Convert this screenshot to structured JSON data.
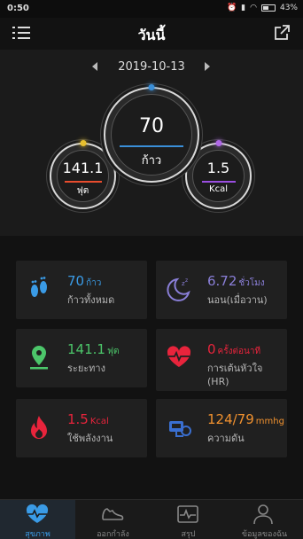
{
  "status_bar": {
    "time": "0:50",
    "battery": "43%",
    "signal": "signal-icon",
    "wifi": "wifi-icon",
    "alarm": "alarm-icon"
  },
  "header": {
    "title": "วันนี้",
    "menu_icon": "menu-icon",
    "share_icon": "share-icon"
  },
  "date_nav": {
    "date": "2019-10-13",
    "prev_icon": "chevron-left-icon",
    "next_icon": "chevron-right-icon"
  },
  "rings": {
    "steps": {
      "value": "70",
      "unit": "ก้าว",
      "color": "#3a8fd9"
    },
    "distance": {
      "value": "141.1",
      "unit": "ฟุต",
      "color": "#e84c2e"
    },
    "calories": {
      "value": "1.5",
      "unit": "Kcal",
      "color": "#9a4ee0"
    }
  },
  "cards": {
    "steps": {
      "value": "70",
      "unit": "ก้าว",
      "label": "ก้าวทั้งหมด",
      "color": "#3a9be6",
      "icon": "footprints-icon"
    },
    "sleep": {
      "value": "6.72",
      "unit": "ชั่วโมง",
      "label": "นอน(เมื่อวาน)",
      "color": "#8a7fd8",
      "icon": "moon-sleep-icon"
    },
    "distance": {
      "value": "141.1",
      "unit": "ฟุต",
      "label": "ระยะทาง",
      "color": "#4cc66a",
      "icon": "location-pin-icon"
    },
    "heart_rate": {
      "value": "0",
      "unit": "ครั้งต่อนาที",
      "label_line1": "การเต้นหัวใจ",
      "label_line2": "(HR)",
      "color": "#e8243c",
      "icon": "heart-pulse-icon"
    },
    "calories": {
      "value": "1.5",
      "unit": "Kcal",
      "label": "ใช้พลังงาน",
      "color": "#e8243c",
      "icon": "flame-icon"
    },
    "blood_pressure": {
      "value": "124/79",
      "unit": "mmhg",
      "label": "ความดัน",
      "color": "#f0912f",
      "icon": "blood-pressure-icon"
    }
  },
  "tabs": [
    {
      "label": "สุขภาพ",
      "icon": "heart-monitor-icon",
      "active": true
    },
    {
      "label": "ออกกำลัง",
      "icon": "shoe-icon",
      "active": false
    },
    {
      "label": "สรุป",
      "icon": "chart-pulse-icon",
      "active": false
    },
    {
      "label": "ข้อมูลของฉัน",
      "icon": "user-icon",
      "active": false
    }
  ]
}
